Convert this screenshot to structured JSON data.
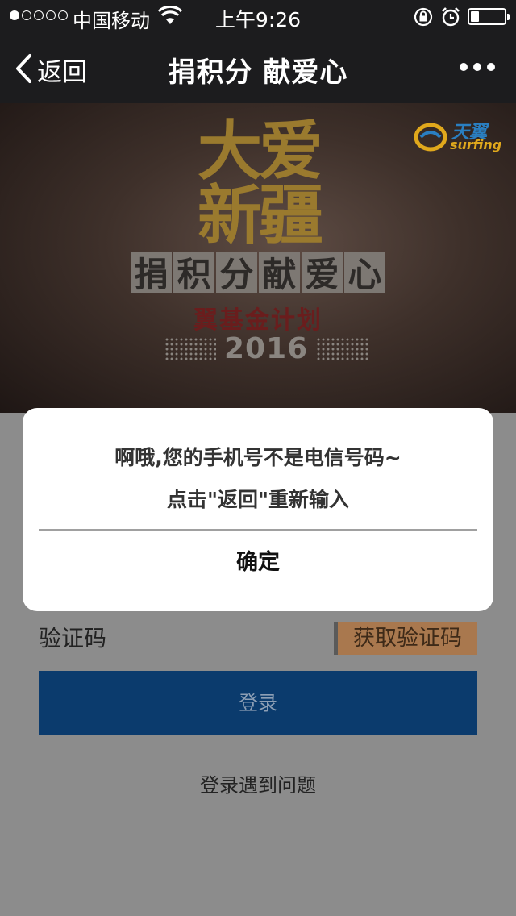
{
  "status_bar": {
    "carrier": "中国移动",
    "time": "上午9:26",
    "signal_strength": 1,
    "signal_max": 5,
    "battery_level": 0.25
  },
  "nav": {
    "back_label": "返回",
    "title": "捐积分 献爱心"
  },
  "banner": {
    "line1": "大爱",
    "line2": "新疆",
    "subtitle_chars": [
      "捐",
      "积",
      "分",
      "献",
      "爱",
      "心"
    ],
    "plan": "翼基金计划",
    "year": "2016",
    "logo_cn": "天翼",
    "logo_en": "surfing"
  },
  "form": {
    "code_label": "验证码",
    "get_code_button": "获取验证码",
    "login_button": "登录",
    "help_link": "登录遇到问题"
  },
  "dialog": {
    "message_line1": "啊哦,您的手机号不是电信号码~",
    "message_line2": "点击\"返回\"重新输入",
    "confirm_label": "确定"
  }
}
